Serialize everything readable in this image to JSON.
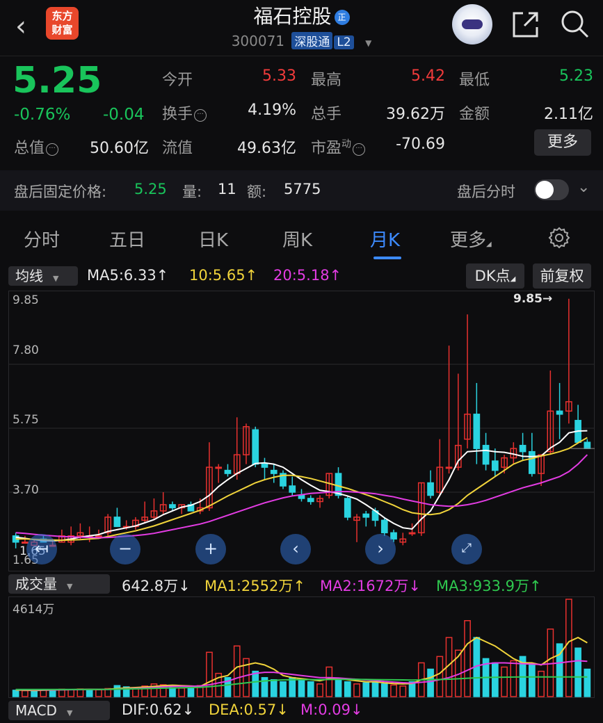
{
  "header": {
    "back_icon": "chevron-left-icon",
    "logo_text": "东方\n财富",
    "stock_name": "福石控股",
    "badge": "正",
    "stock_code": "300071",
    "tag_connect": "深股通",
    "tag_level": "L2",
    "icons": [
      "robot-assistant-icon",
      "share-icon",
      "search-icon"
    ]
  },
  "quote": {
    "price": "5.25",
    "change_pct": "-0.76%",
    "change_amt": "-0.04",
    "market_cap_label": "总值",
    "market_cap": "50.60亿",
    "rows": [
      [
        {
          "label": "今开",
          "value": "5.33",
          "color": "#f13b3b"
        },
        {
          "label": "最高",
          "value": "5.42",
          "color": "#f13b3b"
        },
        {
          "label": "最低",
          "value": "5.23",
          "color": "#19c45b"
        }
      ],
      [
        {
          "label": "换手",
          "value": "4.19%",
          "color": "#e6e6e6"
        },
        {
          "label": "总手",
          "value": "39.62万",
          "color": "#e6e6e6"
        },
        {
          "label": "金额",
          "value": "2.11亿",
          "color": "#e6e6e6"
        }
      ],
      [
        {
          "label": "流值",
          "value": "49.63亿",
          "color": "#e6e6e6"
        },
        {
          "label": "市盈",
          "value": "-70.69",
          "color": "#e6e6e6"
        }
      ]
    ],
    "pe_superscript": "动",
    "more_button": "更多"
  },
  "after_hours": {
    "label": "盘后固定价格:",
    "price": "5.25",
    "vol_label": "量:",
    "vol": "11",
    "amt_label": "额:",
    "amt": "5775",
    "timeshare_label": "盘后分时",
    "toggle_on": false
  },
  "tabs": [
    {
      "label": "分时",
      "active": false
    },
    {
      "label": "五日",
      "active": false
    },
    {
      "label": "日K",
      "active": false
    },
    {
      "label": "周K",
      "active": false
    },
    {
      "label": "月K",
      "active": true
    },
    {
      "label": "更多",
      "active": false
    }
  ],
  "settings_icon": "gear-icon",
  "ma_bar": {
    "selector": "均线",
    "ma5": "MA5:6.33↑",
    "ma10": "10:5.65↑",
    "ma20": "20:5.18↑",
    "dk_button": "DK点",
    "adjust_button": "前复权"
  },
  "kline": {
    "y_labels": [
      "9.85",
      "7.80",
      "5.75",
      "3.70",
      "1.65"
    ],
    "max_marker": "9.85→",
    "min_marker": "1.65",
    "controls": [
      "left-arrow-icon",
      "minus-icon",
      "plus-icon",
      "prev-icon",
      "next-icon",
      "fullscreen-icon"
    ]
  },
  "vol_bar": {
    "selector": "成交量",
    "current": "642.8万↓",
    "ma1": "MA1:2552万↑",
    "ma2": "MA2:1672万↓",
    "ma3": "MA3:933.9万↑",
    "top_label": "4614万"
  },
  "macd_bar": {
    "selector": "MACD",
    "dif": "DIF:0.62↓",
    "dea": "DEA:0.57↓",
    "m": "M:0.09↓"
  },
  "chart_data": {
    "type": "candlestick",
    "ylim": [
      1.65,
      9.85
    ],
    "candles": [
      [
        2.3,
        2.4,
        2.1,
        1.9
      ],
      [
        2.1,
        2.3,
        2.1,
        2.1
      ],
      [
        2.0,
        2.2,
        2.1,
        2.1
      ],
      [
        2.2,
        2.3,
        2.1,
        2.1
      ],
      [
        2.0,
        2.2,
        2.0,
        2.0
      ],
      [
        2.1,
        2.5,
        2.3,
        2.1
      ],
      [
        2.1,
        2.6,
        2.3,
        2.0
      ],
      [
        2.3,
        2.7,
        2.4,
        2.2
      ],
      [
        2.3,
        2.6,
        2.3,
        2.1
      ],
      [
        2.3,
        2.5,
        2.3,
        2.2
      ],
      [
        2.4,
        3.0,
        2.9,
        2.3
      ],
      [
        2.9,
        3.2,
        2.6,
        2.6
      ],
      [
        2.6,
        2.8,
        2.6,
        2.5
      ],
      [
        2.6,
        2.9,
        2.8,
        2.5
      ],
      [
        2.8,
        3.4,
        2.9,
        2.7
      ],
      [
        2.9,
        3.5,
        3.1,
        2.8
      ],
      [
        3.1,
        3.7,
        3.3,
        3.0
      ],
      [
        3.3,
        3.4,
        3.2,
        3.1
      ],
      [
        3.2,
        3.3,
        3.3,
        3.0
      ],
      [
        3.3,
        3.4,
        3.1,
        3.1
      ],
      [
        3.1,
        3.5,
        3.2,
        3.0
      ],
      [
        3.2,
        5.3,
        4.5,
        3.1
      ],
      [
        4.5,
        4.6,
        4.5,
        4.0
      ],
      [
        4.4,
        4.6,
        4.3,
        4.2
      ],
      [
        4.3,
        6.1,
        4.9,
        4.1
      ],
      [
        4.9,
        5.9,
        5.8,
        4.6
      ],
      [
        5.7,
        5.8,
        4.6,
        4.5
      ],
      [
        4.6,
        4.8,
        4.5,
        4.1
      ],
      [
        4.4,
        4.6,
        4.3,
        4.0
      ],
      [
        4.3,
        4.4,
        3.9,
        3.8
      ],
      [
        3.9,
        4.2,
        3.7,
        3.6
      ],
      [
        3.6,
        3.8,
        3.5,
        3.4
      ],
      [
        3.5,
        3.6,
        3.4,
        3.3
      ],
      [
        3.4,
        3.6,
        3.5,
        3.2
      ],
      [
        3.6,
        4.3,
        4.3,
        3.5
      ],
      [
        4.3,
        4.5,
        3.6,
        3.5
      ],
      [
        3.5,
        3.6,
        2.9,
        2.8
      ],
      [
        2.8,
        3.0,
        2.9,
        2.1
      ],
      [
        3.0,
        3.1,
        2.9,
        2.6
      ],
      [
        3.1,
        3.2,
        2.8,
        2.6
      ],
      [
        2.8,
        2.9,
        2.4,
        2.3
      ],
      [
        2.4,
        2.5,
        2.2,
        2.1
      ],
      [
        2.1,
        2.4,
        2.2,
        2.0
      ],
      [
        2.4,
        2.7,
        2.4,
        2.3
      ],
      [
        2.4,
        4.0,
        4.0,
        2.3
      ],
      [
        4.0,
        4.4,
        3.6,
        3.5
      ],
      [
        3.7,
        5.4,
        4.5,
        3.6
      ],
      [
        4.5,
        8.4,
        4.5,
        4.3
      ],
      [
        4.5,
        7.5,
        5.2,
        4.4
      ],
      [
        5.4,
        9.4,
        6.2,
        5.1
      ],
      [
        6.2,
        7.2,
        5.1,
        4.6
      ],
      [
        5.2,
        5.6,
        4.6,
        4.4
      ],
      [
        4.7,
        5.1,
        4.4,
        4.2
      ],
      [
        4.5,
        4.9,
        4.8,
        4.3
      ],
      [
        4.8,
        5.3,
        5.1,
        4.6
      ],
      [
        5.2,
        5.6,
        5.0,
        4.7
      ],
      [
        5.0,
        5.6,
        4.3,
        4.2
      ],
      [
        4.3,
        4.9,
        4.9,
        3.9
      ],
      [
        5.0,
        7.6,
        6.3,
        4.9
      ],
      [
        6.3,
        7.2,
        6.2,
        5.4
      ],
      [
        6.3,
        9.9,
        6.6,
        5.9
      ],
      [
        6.0,
        6.5,
        5.3,
        5.3
      ],
      [
        5.3,
        5.4,
        5.1,
        5.1
      ]
    ],
    "ma5": [
      2.26,
      2.22,
      2.18,
      2.15,
      2.14,
      2.16,
      2.2,
      2.26,
      2.3,
      2.34,
      2.44,
      2.5,
      2.56,
      2.62,
      2.72,
      2.82,
      2.98,
      3.1,
      3.22,
      3.28,
      3.4,
      3.6,
      3.88,
      4.1,
      4.3,
      4.46,
      4.62,
      4.64,
      4.6,
      4.5,
      4.3,
      4.1,
      3.92,
      3.76,
      3.72,
      3.66,
      3.58,
      3.48,
      3.3,
      3.1,
      2.88,
      2.7,
      2.56,
      2.52,
      2.84,
      3.1,
      3.6,
      4.1,
      4.7,
      5.0,
      5.02,
      5.04,
      5.0,
      4.98,
      4.92,
      4.85,
      4.84,
      4.86,
      5.12,
      5.3,
      5.6,
      5.66,
      5.67
    ],
    "ma10": [
      2.2,
      2.2,
      2.19,
      2.18,
      2.17,
      2.16,
      2.17,
      2.18,
      2.2,
      2.22,
      2.28,
      2.34,
      2.4,
      2.46,
      2.54,
      2.62,
      2.72,
      2.82,
      2.92,
      3.02,
      3.12,
      3.26,
      3.42,
      3.58,
      3.72,
      3.86,
      4.0,
      4.1,
      4.18,
      4.24,
      4.24,
      4.2,
      4.14,
      4.06,
      3.98,
      3.9,
      3.82,
      3.72,
      3.62,
      3.52,
      3.4,
      3.28,
      3.14,
      3.04,
      3.0,
      2.98,
      3.02,
      3.14,
      3.34,
      3.6,
      3.8,
      4.0,
      4.2,
      4.4,
      4.6,
      4.72,
      4.78,
      4.86,
      4.92,
      5.0,
      5.1,
      5.28,
      5.45
    ],
    "ma20": [
      2.4,
      2.38,
      2.35,
      2.32,
      2.3,
      2.28,
      2.27,
      2.26,
      2.25,
      2.24,
      2.25,
      2.27,
      2.29,
      2.31,
      2.34,
      2.38,
      2.44,
      2.5,
      2.56,
      2.62,
      2.68,
      2.76,
      2.86,
      2.96,
      3.06,
      3.16,
      3.26,
      3.36,
      3.44,
      3.52,
      3.58,
      3.62,
      3.66,
      3.68,
      3.7,
      3.72,
      3.72,
      3.7,
      3.68,
      3.65,
      3.6,
      3.55,
      3.48,
      3.42,
      3.36,
      3.3,
      3.27,
      3.25,
      3.26,
      3.3,
      3.36,
      3.44,
      3.54,
      3.64,
      3.74,
      3.84,
      3.92,
      4.0,
      4.1,
      4.2,
      4.36,
      4.6,
      4.9
    ],
    "volumes": [
      300,
      280,
      260,
      320,
      300,
      350,
      330,
      360,
      340,
      320,
      380,
      520,
      460,
      420,
      500,
      600,
      560,
      420,
      400,
      380,
      520,
      2100,
      1100,
      900,
      2400,
      1800,
      1200,
      900,
      800,
      700,
      900,
      800,
      700,
      600,
      1400,
      800,
      700,
      600,
      650,
      700,
      600,
      550,
      500,
      700,
      1600,
      1300,
      1900,
      2800,
      2200,
      3600,
      2800,
      1800,
      1600,
      1400,
      1700,
      1900,
      1500,
      1200,
      3200,
      2500,
      4614,
      2300,
      1300
    ],
    "vol_up": [
      0,
      1,
      0,
      1,
      0,
      1,
      1,
      1,
      0,
      1,
      1,
      0,
      0,
      1,
      1,
      1,
      1,
      0,
      1,
      0,
      1,
      1,
      1,
      0,
      1,
      1,
      0,
      0,
      0,
      0,
      0,
      0,
      0,
      1,
      1,
      0,
      0,
      1,
      0,
      0,
      0,
      1,
      1,
      0,
      1,
      0,
      1,
      1,
      1,
      1,
      0,
      0,
      0,
      1,
      1,
      0,
      0,
      1,
      1,
      0,
      1,
      0,
      0
    ],
    "vol_ma1": [
      310,
      300,
      290,
      300,
      310,
      320,
      330,
      340,
      345,
      340,
      350,
      380,
      410,
      430,
      450,
      480,
      520,
      540,
      520,
      500,
      480,
      700,
      900,
      1000,
      1400,
      1500,
      1600,
      1500,
      1300,
      1000,
      900,
      850,
      800,
      750,
      850,
      850,
      800,
      750,
      700,
      700,
      650,
      620,
      600,
      620,
      800,
      900,
      1100,
      1500,
      1900,
      2500,
      2800,
      2600,
      2400,
      2100,
      1800,
      1600,
      1600,
      1500,
      1800,
      2000,
      2600,
      2800,
      2550
    ],
    "vol_ma2": [
      330,
      320,
      315,
      315,
      315,
      320,
      325,
      330,
      335,
      335,
      340,
      350,
      370,
      390,
      410,
      430,
      460,
      480,
      490,
      490,
      500,
      560,
      650,
      730,
      880,
      1000,
      1100,
      1150,
      1150,
      1100,
      1050,
      1000,
      950,
      900,
      900,
      880,
      850,
      820,
      790,
      760,
      720,
      690,
      660,
      640,
      680,
      720,
      800,
      900,
      1050,
      1250,
      1450,
      1550,
      1600,
      1600,
      1580,
      1560,
      1540,
      1520,
      1560,
      1600,
      1650,
      1700,
      1672
    ],
    "vol_ma3": [
      340,
      340,
      335,
      335,
      335,
      335,
      336,
      338,
      340,
      342,
      344,
      350,
      358,
      366,
      375,
      385,
      398,
      410,
      420,
      430,
      440,
      470,
      510,
      550,
      600,
      650,
      700,
      740,
      770,
      790,
      800,
      805,
      805,
      805,
      810,
      815,
      815,
      815,
      810,
      805,
      800,
      795,
      790,
      785,
      790,
      800,
      810,
      825,
      845,
      870,
      890,
      905,
      915,
      920,
      925,
      928,
      930,
      930,
      932,
      933,
      934,
      934,
      934
    ]
  }
}
